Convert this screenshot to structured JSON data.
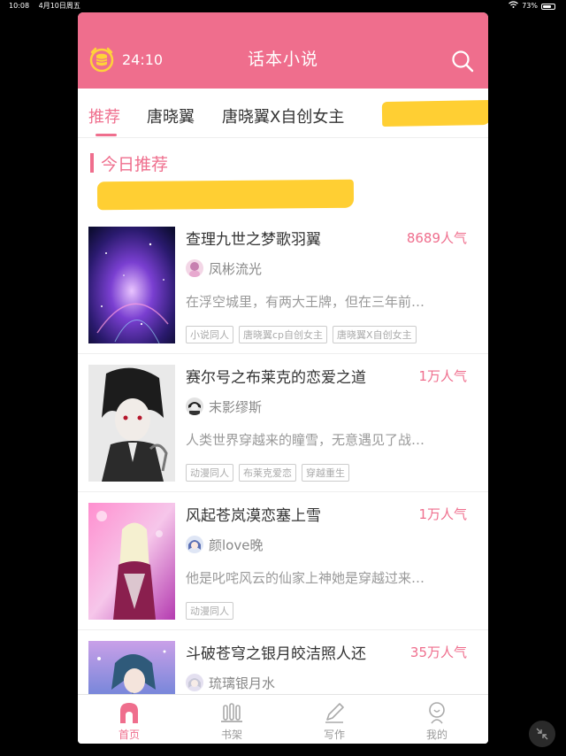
{
  "statusbar": {
    "time": "10:08",
    "date": "4月10日周五",
    "battery": "73%",
    "battery_level": 0.73
  },
  "header": {
    "timer": "24:10",
    "title": "话本小说"
  },
  "tabs": [
    {
      "label": "推荐",
      "active": true
    },
    {
      "label": "唐晓翼",
      "active": false
    },
    {
      "label": "唐晓翼X自创女主",
      "active": false
    }
  ],
  "section": {
    "title": "今日推荐"
  },
  "books": [
    {
      "title": "查理九世之梦歌羽翼",
      "popularity": "8689人气",
      "author": "凤彬流光",
      "summary": "在浮空城里，有两大王牌，但在三年前…",
      "tags": [
        "小说同人",
        "唐晓翼cp自创女主",
        "唐晓翼X自创女主"
      ]
    },
    {
      "title": "赛尔号之布莱克的恋爱之道",
      "popularity": "1万人气",
      "author": "末影缪斯",
      "summary": "人类世界穿越来的瞳雪，无意遇见了战…",
      "tags": [
        "动漫同人",
        "布莱克爱恋",
        "穿越重生"
      ]
    },
    {
      "title": "风起苍岚漠恋塞上雪",
      "popularity": "1万人气",
      "author": "颜love晚",
      "summary": "他是叱咤风云的仙家上神她是穿越过来…",
      "tags": [
        "动漫同人"
      ]
    },
    {
      "title": "斗破苍穹之银月皎洁照人还",
      "popularity": "35万人气",
      "author": "琉璃银月水",
      "summary": "",
      "tags": []
    }
  ],
  "nav": [
    {
      "label": "首页",
      "active": true
    },
    {
      "label": "书架",
      "active": false
    },
    {
      "label": "写作",
      "active": false
    },
    {
      "label": "我的",
      "active": false
    }
  ],
  "colors": {
    "brand": "#ef6e8d",
    "highlight": "#ffcf33"
  }
}
